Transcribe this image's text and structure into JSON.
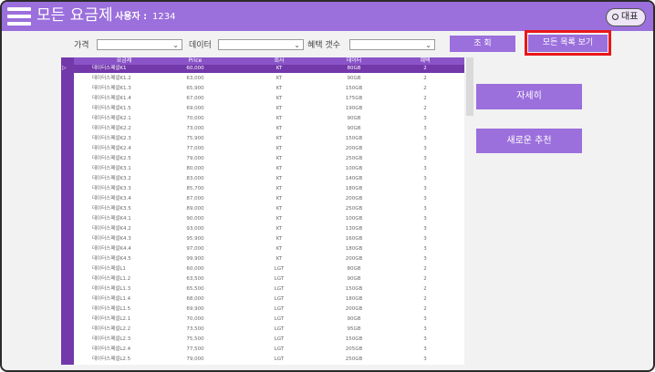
{
  "header": {
    "title": "모든 요금제",
    "user_label": "사용자 :",
    "user_id": "1234",
    "profile_button": "대표"
  },
  "filters": {
    "price_label": "가격",
    "data_label": "데이터",
    "benefit_label": "혜택 갯수",
    "price_value": "",
    "data_value": "",
    "benefit_value": ""
  },
  "buttons": {
    "search": "조 회",
    "show_all": "모든 목록 보기",
    "details": "자세히",
    "new_recommend": "새로운 추천"
  },
  "table": {
    "columns": [
      "요금제",
      "Price",
      "회사",
      "데이터",
      "혜택"
    ],
    "rows": [
      [
        "데이터스페셜K1",
        "60,000",
        "KT",
        "80GB",
        "2"
      ],
      [
        "데이터스페셜K1.2",
        "63,000",
        "KT",
        "90GB",
        "2"
      ],
      [
        "데이터스페셜K1.3",
        "65,900",
        "KT",
        "150GB",
        "2"
      ],
      [
        "데이터스페셜K1.4",
        "67,000",
        "KT",
        "175GB",
        "2"
      ],
      [
        "데이터스페셜K1.5",
        "69,000",
        "KT",
        "190GB",
        "2"
      ],
      [
        "데이터스페셜K2.1",
        "70,000",
        "KT",
        "90GB",
        "3"
      ],
      [
        "데이터스페셜K2.2",
        "73,000",
        "KT",
        "90GB",
        "3"
      ],
      [
        "데이터스페셜K2.3",
        "75,900",
        "KT",
        "150GB",
        "3"
      ],
      [
        "데이터스페셜K2.4",
        "77,000",
        "KT",
        "200GB",
        "3"
      ],
      [
        "데이터스페셜K2.5",
        "79,000",
        "KT",
        "250GB",
        "3"
      ],
      [
        "데이터스페셜K3.1",
        "80,000",
        "KT",
        "100GB",
        "3"
      ],
      [
        "데이터스페셜K3.2",
        "83,000",
        "KT",
        "140GB",
        "3"
      ],
      [
        "데이터스페셜K3.3",
        "85,700",
        "KT",
        "180GB",
        "3"
      ],
      [
        "데이터스페셜K3.4",
        "87,000",
        "KT",
        "200GB",
        "3"
      ],
      [
        "데이터스페셜K3.5",
        "89,000",
        "KT",
        "250GB",
        "3"
      ],
      [
        "데이터스페셜K4.1",
        "90,000",
        "KT",
        "100GB",
        "3"
      ],
      [
        "데이터스페셜K4.2",
        "93,000",
        "KT",
        "130GB",
        "3"
      ],
      [
        "데이터스페셜K4.3",
        "95,900",
        "KT",
        "160GB",
        "3"
      ],
      [
        "데이터스페셜K4.4",
        "97,000",
        "KT",
        "180GB",
        "3"
      ],
      [
        "데이터스페셜K4.5",
        "99,900",
        "KT",
        "200GB",
        "3"
      ],
      [
        "데이터스페셜L1",
        "60,000",
        "LGT",
        "80GB",
        "2"
      ],
      [
        "데이터스페셜L1.2",
        "63,500",
        "LGT",
        "90GB",
        "2"
      ],
      [
        "데이터스페셜L1.3",
        "65,500",
        "LGT",
        "150GB",
        "2"
      ],
      [
        "데이터스페셜L1.4",
        "68,000",
        "LGT",
        "180GB",
        "2"
      ],
      [
        "데이터스페셜L1.5",
        "69,900",
        "LGT",
        "200GB",
        "2"
      ],
      [
        "데이터스페셜L2.1",
        "70,000",
        "LGT",
        "90GB",
        "3"
      ],
      [
        "데이터스페셜L2.2",
        "73,500",
        "LGT",
        "95GB",
        "3"
      ],
      [
        "데이터스페셜L2.3",
        "75,500",
        "LGT",
        "150GB",
        "3"
      ],
      [
        "데이터스페셜L2.4",
        "77,500",
        "LGT",
        "205GB",
        "3"
      ],
      [
        "데이터스페셜L2.5",
        "79,000",
        "LGT",
        "250GB",
        "3"
      ]
    ],
    "selected_row": 0,
    "selected_marker": "▷"
  },
  "colors": {
    "accent": "#9b6fdc",
    "header_dark": "#7338aa",
    "highlight": "#e8171b"
  }
}
